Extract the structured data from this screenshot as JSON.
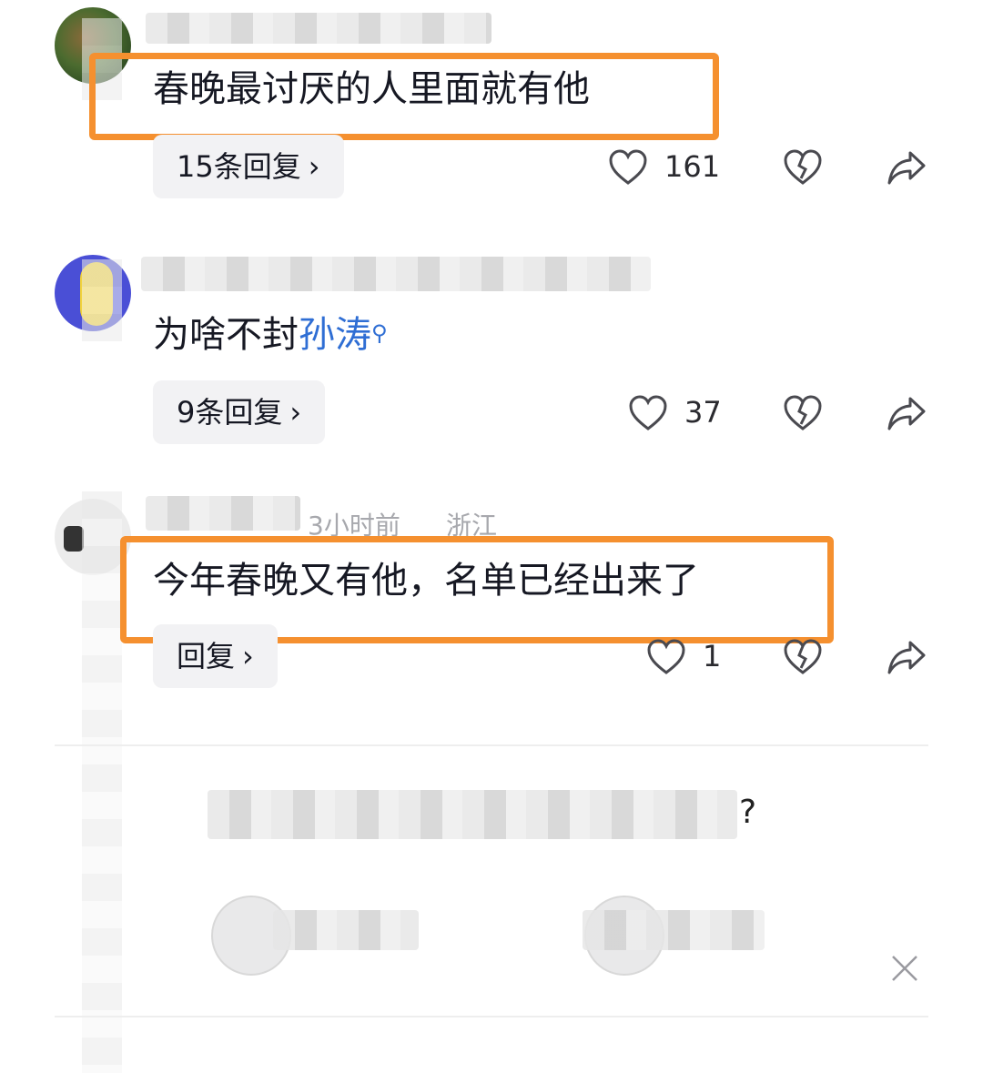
{
  "comments": [
    {
      "text": "春晚最讨厌的人里面就有他",
      "reply_label": "15条回复",
      "like_count": "161"
    },
    {
      "text_prefix": "为啥不封",
      "hashtag": "孙涛",
      "search_icon_glyph": "⚲",
      "reply_label": "9条回复",
      "like_count": "37"
    },
    {
      "meta_time": "3小时前",
      "meta_location": "浙江",
      "text": "今年春晚又有他，名单已经出来了",
      "reply_label": "回复",
      "like_count": "1"
    }
  ],
  "survey": {
    "question_end": "?"
  },
  "colors": {
    "highlight": "#f5902f",
    "hashtag": "#2f6ed4"
  },
  "icons": {
    "like": "heart-icon",
    "dislike": "broken-heart-icon",
    "share": "share-arrow-icon",
    "search": "search-icon",
    "close": "close-icon",
    "chevron": "chevron-right-icon"
  }
}
